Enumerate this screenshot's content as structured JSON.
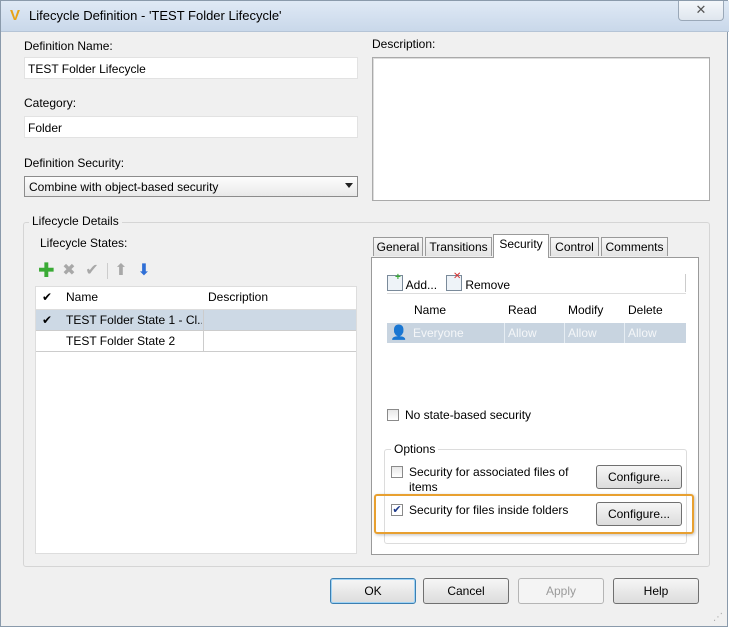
{
  "window": {
    "title": "Lifecycle Definition - 'TEST Folder Lifecycle'",
    "close_glyph": "✕"
  },
  "form": {
    "definition_name_label": "Definition Name:",
    "definition_name_value": "TEST Folder Lifecycle",
    "category_label": "Category:",
    "category_value": "Folder",
    "definition_security_label": "Definition Security:",
    "definition_security_value": "Combine with object-based security",
    "description_label": "Description:",
    "description_value": ""
  },
  "details": {
    "group_label": "Lifecycle Details",
    "states_label": "Lifecycle States:",
    "toolbar_icons": [
      "add-icon",
      "delete-icon",
      "checkmark-icon",
      "move-up-icon",
      "move-down-icon"
    ],
    "columns": {
      "check": "✔",
      "name": "Name",
      "description": "Description"
    },
    "states": [
      {
        "check": "✔",
        "name": "TEST Folder State 1 - Cl...",
        "description": "",
        "selected": true
      },
      {
        "check": "",
        "name": "TEST Folder State 2",
        "description": "",
        "selected": false
      }
    ]
  },
  "tabs": [
    {
      "label": "General",
      "active": false
    },
    {
      "label": "Transitions",
      "active": false
    },
    {
      "label": "Security",
      "active": true
    },
    {
      "label": "Control",
      "active": false
    },
    {
      "label": "Comments",
      "active": false
    }
  ],
  "security": {
    "add_label": "Add...",
    "remove_label": "Remove",
    "columns": {
      "name": "Name",
      "read": "Read",
      "modify": "Modify",
      "delete": "Delete"
    },
    "entries": [
      {
        "name": "Everyone",
        "read": "Allow",
        "modify": "Allow",
        "delete": "Allow"
      }
    ],
    "no_state_security_label": "No state-based security",
    "no_state_security_checked": false,
    "options_label": "Options",
    "assoc_files_label": "Security for associated files of items",
    "assoc_files_checked": false,
    "configure_label": "Configure...",
    "folders_label": "Security for files inside folders",
    "folders_checked": true
  },
  "buttons": {
    "ok": "OK",
    "cancel": "Cancel",
    "apply": "Apply",
    "help": "Help"
  },
  "colors": {
    "selection": "#cdd9e5",
    "highlight": "#e8a030",
    "add_icon": "#3aaa35",
    "arrow_down": "#2f6fd6"
  }
}
